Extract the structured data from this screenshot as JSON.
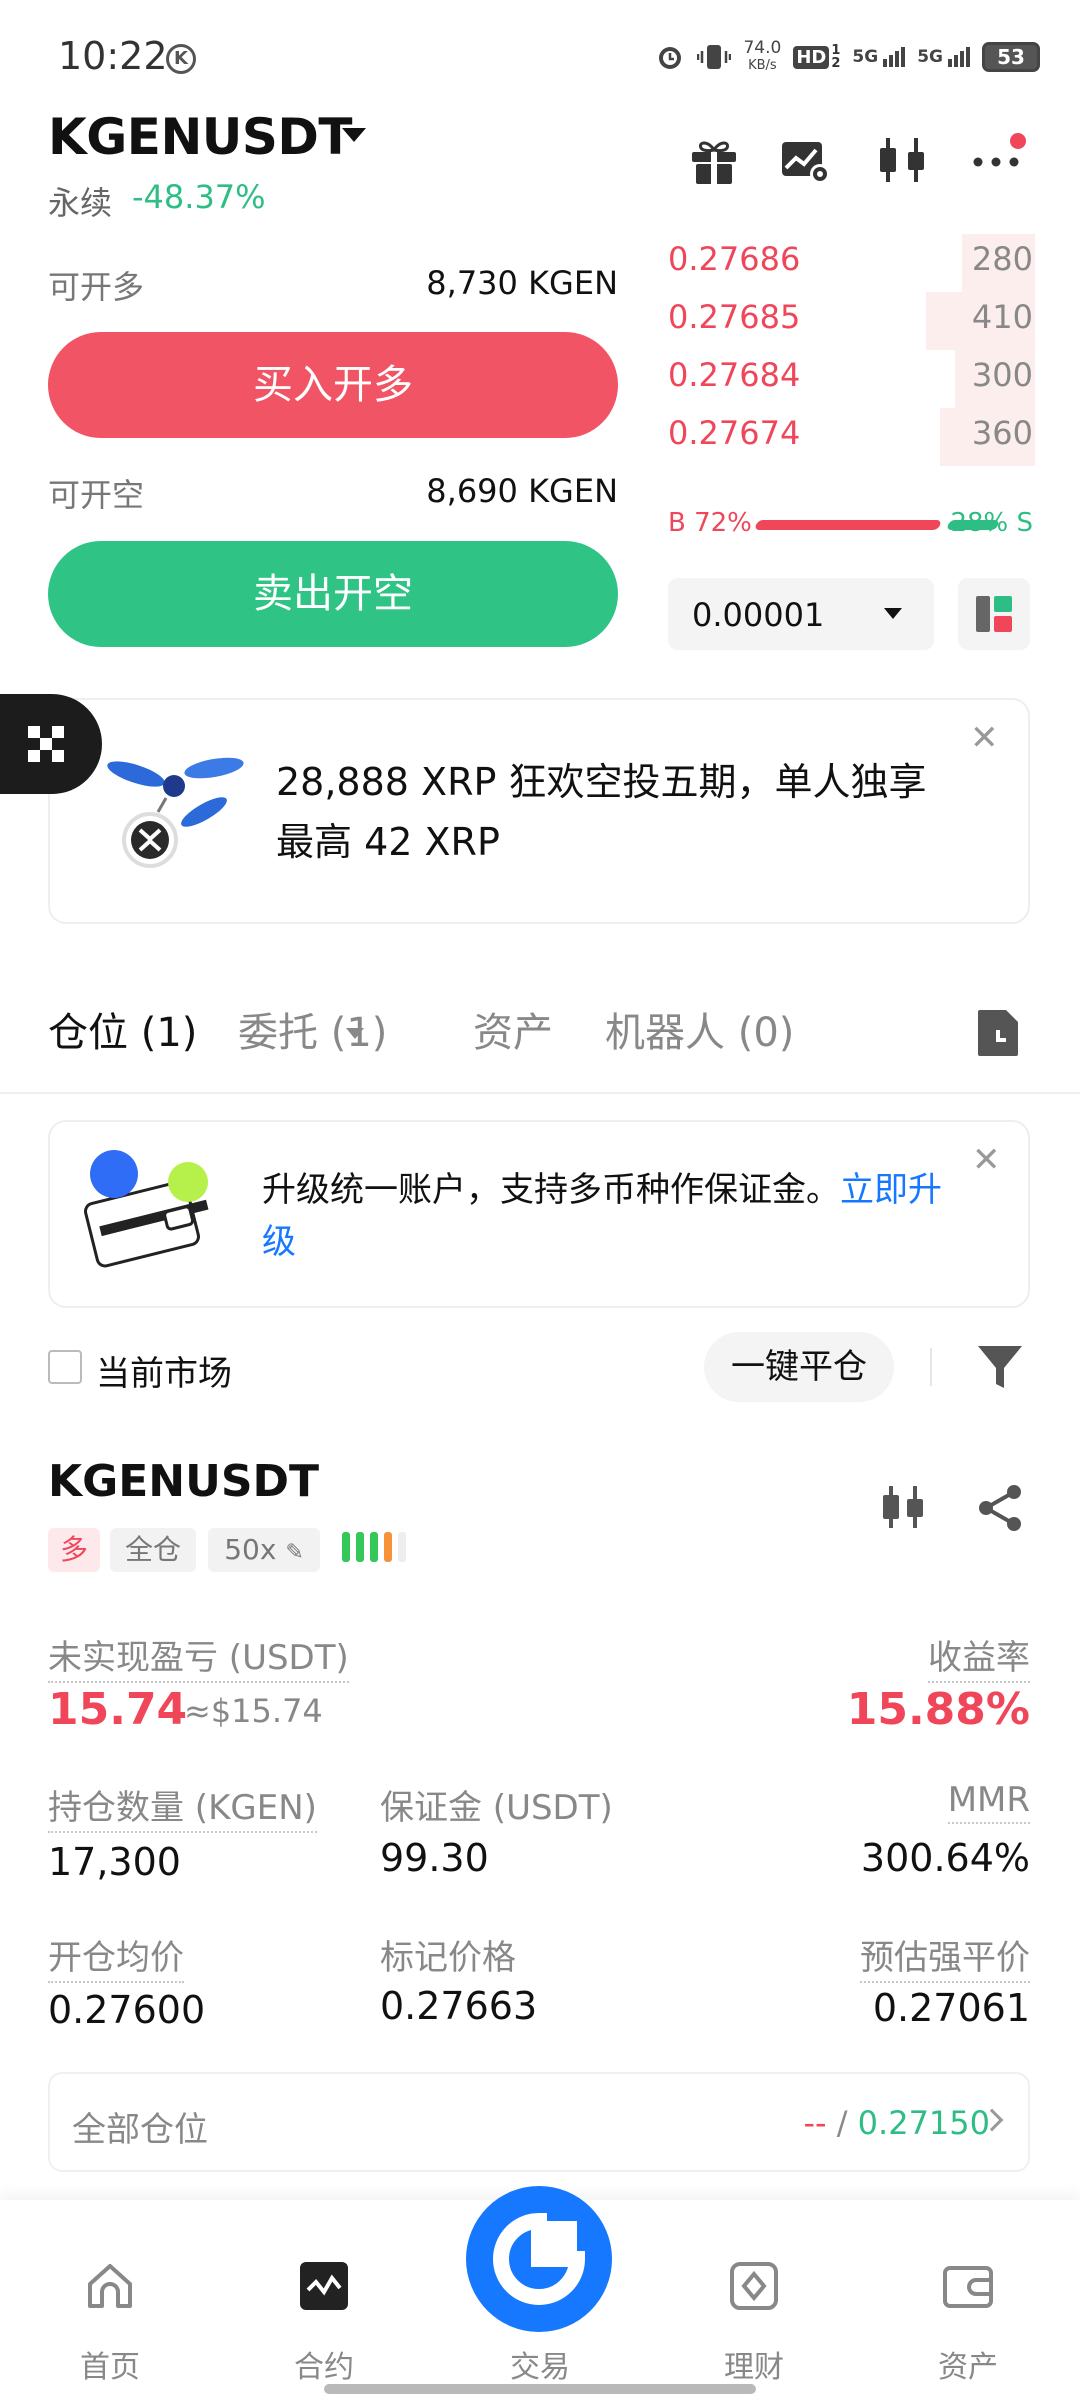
{
  "status_bar": {
    "time": "10:22",
    "k_badge": "K",
    "net_speed": "74.0",
    "net_unit": "KB/s",
    "hd": "HD",
    "hd_sub": "1",
    "hd_sub2": "2",
    "sig1": "5G",
    "sig2": "5G",
    "battery": "53"
  },
  "header": {
    "symbol": "KGENUSDT",
    "perp_label": "永续",
    "change": "-48.37%"
  },
  "order_panel": {
    "long_avail_label": "可开多",
    "long_avail_value": "8,730 KGEN",
    "buy_button": "买入开多",
    "short_avail_label": "可开空",
    "short_avail_value": "8,690 KGEN",
    "sell_button": "卖出开空"
  },
  "orderbook": {
    "asks": [
      {
        "price": "0.27686",
        "qty": "280",
        "depth": 0.2
      },
      {
        "price": "0.27685",
        "qty": "410",
        "depth": 0.3
      },
      {
        "price": "0.27684",
        "qty": "300",
        "depth": 0.22
      },
      {
        "price": "0.27674",
        "qty": "360",
        "depth": 0.26
      }
    ],
    "buy_ratio": "B 72%",
    "sell_ratio": "28% S",
    "tick_size": "0.00001"
  },
  "promo": {
    "text": "28,888 XRP 狂欢空投五期，单人独享最高 42 XRP"
  },
  "tabs": {
    "positions": "仓位 (1)",
    "orders": "委托 (1)",
    "assets": "资产",
    "bots": "机器人 (0)"
  },
  "upgrade": {
    "text": "升级统一账户，支持多币种作保证金。",
    "link": "立即升级"
  },
  "filter": {
    "current_market": "当前市场",
    "close_all": "一键平仓"
  },
  "position": {
    "symbol": "KGENUSDT",
    "side": "多",
    "margin_mode": "全仓",
    "leverage": "50x",
    "upnl_label": "未实现盈亏 (USDT)",
    "upnl_value": "15.74",
    "upnl_usd": "≈$15.74",
    "roe_label": "收益率",
    "roe_value": "15.88%",
    "size_label": "持仓数量 (KGEN)",
    "size_value": "17,300",
    "margin_label": "保证金 (USDT)",
    "margin_value": "99.30",
    "mmr_label": "MMR",
    "mmr_value": "300.64%",
    "entry_label": "开仓均价",
    "entry_value": "0.27600",
    "mark_label": "标记价格",
    "mark_value": "0.27663",
    "liq_label": "预估强平价",
    "liq_value": "0.27061",
    "all_positions_label": "全部仓位",
    "all_positions_dash": "--",
    "all_positions_sep": " / ",
    "all_positions_value": "0.27150"
  },
  "bottom_nav": {
    "home": "首页",
    "futures": "合约",
    "trade": "交易",
    "earn": "理财",
    "assets": "资产"
  },
  "colors": {
    "green": "#2ebd85",
    "red": "#f0465a",
    "orange": "#f7923a",
    "blue": "#1677ff"
  }
}
